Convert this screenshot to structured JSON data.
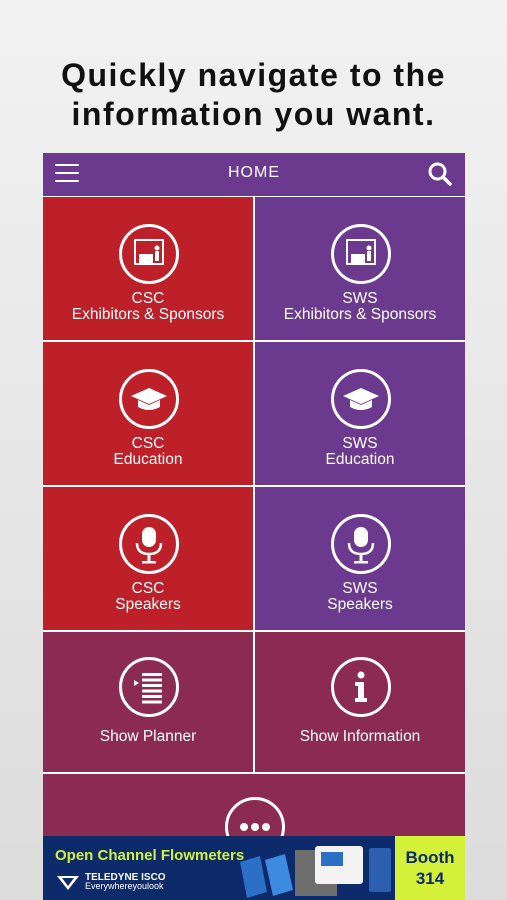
{
  "headline": {
    "line1": "Quickly navigate to the",
    "line2": "information you want."
  },
  "topbar": {
    "title": "HOME",
    "color": "#6b3a8e"
  },
  "colors": {
    "csc": "#bd2029",
    "sws": "#6b3a8e",
    "planner": "#8c2b52"
  },
  "tiles": [
    {
      "line1": "CSC",
      "line2": "Exhibitors & Sponsors",
      "icon": "exhibitor-booth-icon"
    },
    {
      "line1": "SWS",
      "line2": "Exhibitors & Sponsors",
      "icon": "exhibitor-booth-icon"
    },
    {
      "line1": "CSC",
      "line2": "Education",
      "icon": "graduation-cap-icon"
    },
    {
      "line1": "SWS",
      "line2": "Education",
      "icon": "graduation-cap-icon"
    },
    {
      "line1": "CSC",
      "line2": "Speakers",
      "icon": "microphone-icon"
    },
    {
      "line1": "SWS",
      "line2": "Speakers",
      "icon": "microphone-icon"
    },
    {
      "label": "Show Planner",
      "icon": "planner-list-icon"
    },
    {
      "label": "Show Information",
      "icon": "info-icon"
    },
    {
      "icon": "more-icon"
    }
  ],
  "ad": {
    "title": "Open Channel Flowmeters",
    "brand": "TELEDYNE ISCO",
    "tagline": "Everywhereyoulook",
    "booth_line1": "Booth",
    "booth_line2": "314"
  }
}
